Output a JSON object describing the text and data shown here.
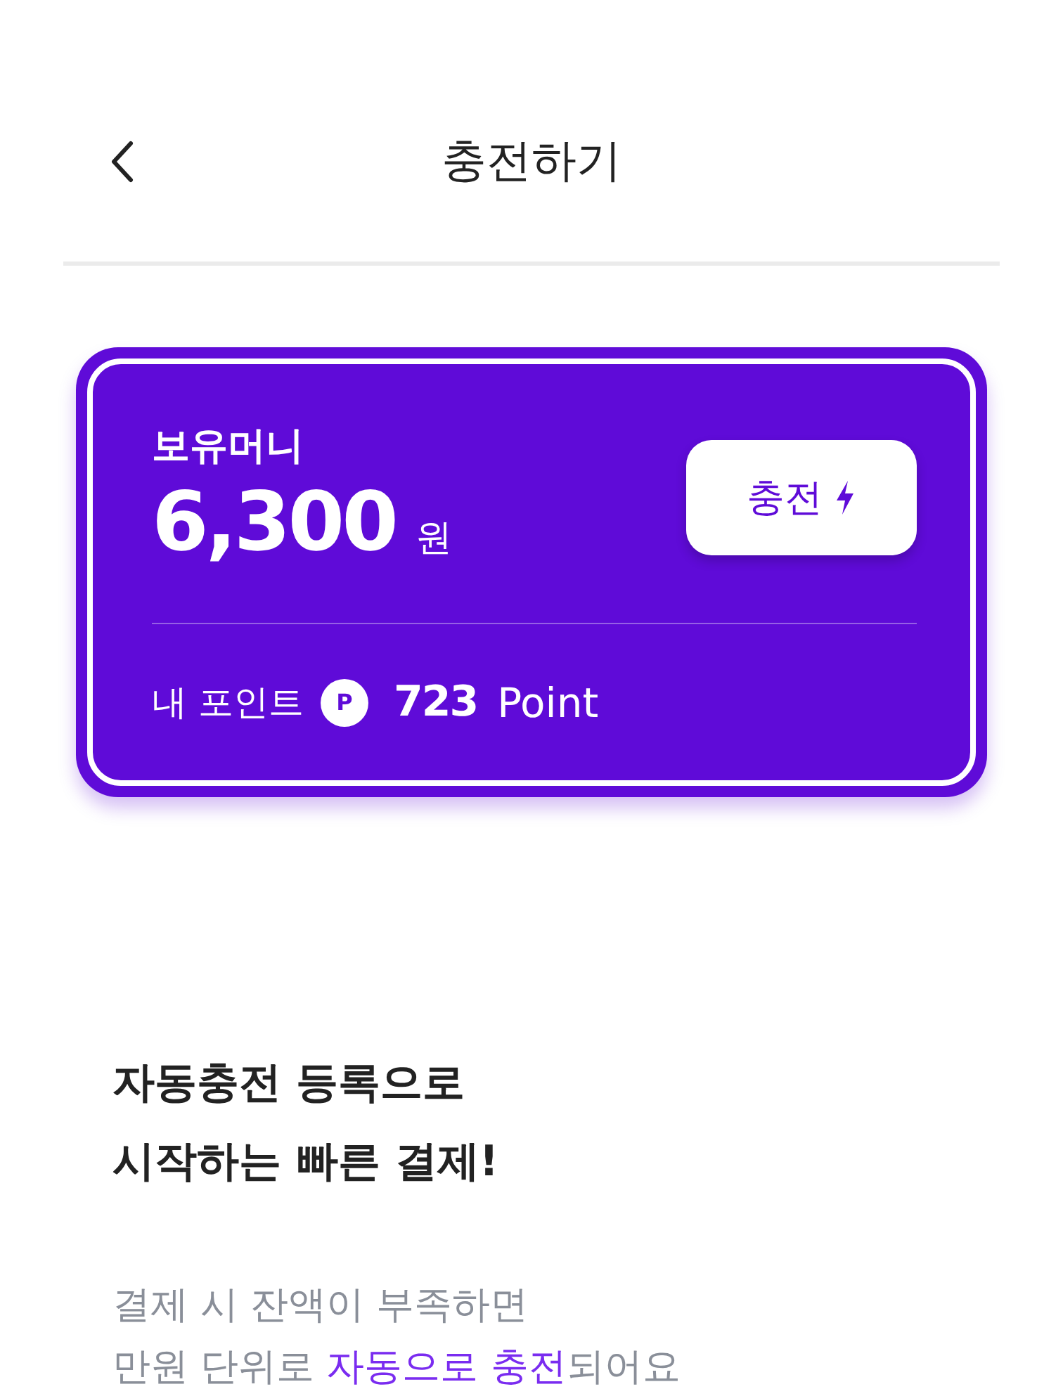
{
  "header": {
    "title": "충전하기"
  },
  "balance_card": {
    "label": "보유머니",
    "amount": "6,300",
    "unit": "원",
    "charge_button": "충전",
    "points_label": "내 포인트",
    "point_badge": "P",
    "points": "723",
    "points_unit": "Point"
  },
  "promo": {
    "heading_lines": [
      "자동충전 등록으로",
      "시작하는 빠른 결제!"
    ],
    "description_lines": [
      [
        {
          "text": "결제 시 잔액이 부족하면",
          "highlight": false
        }
      ],
      [
        {
          "text": "만원 단위로 ",
          "highlight": false
        },
        {
          "text": "자동으로 충전",
          "highlight": true
        },
        {
          "text": "되어요",
          "highlight": false
        }
      ]
    ]
  }
}
